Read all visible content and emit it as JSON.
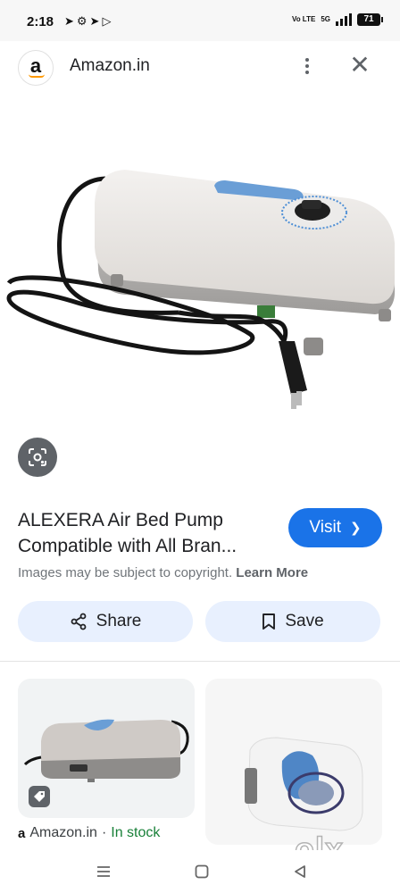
{
  "status_bar": {
    "time": "2:18",
    "network_label": "Vo LTE",
    "network_type": "5G",
    "battery": "71"
  },
  "header": {
    "site_logo_letter": "a",
    "site_name": "Amazon.in",
    "more_icon": "more-vert-icon",
    "close_icon": "close-icon"
  },
  "product": {
    "title": "ALEXERA Air Bed Pump Compatible with All Bran...",
    "visit_label": "Visit",
    "copyright_text": "Images may be subject to copyright.",
    "learn_more_label": "Learn More",
    "share_label": "Share",
    "save_label": "Save"
  },
  "related": {
    "source_name": "Amazon.in",
    "separator": "·",
    "stock_status": "In stock"
  },
  "watermark": "olx",
  "colors": {
    "accent": "#1a73e8",
    "chip_bg": "#e8f0fe",
    "in_stock": "#188038",
    "amazon_orange": "#ff9900"
  }
}
